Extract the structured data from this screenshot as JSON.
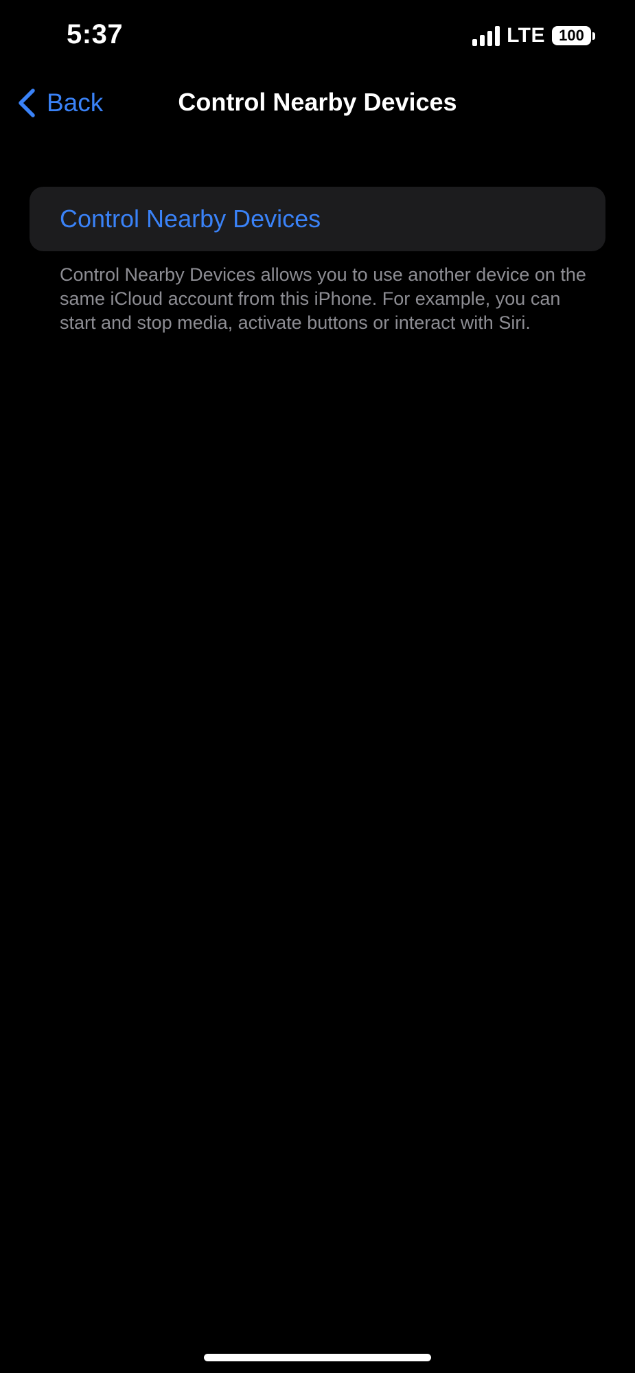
{
  "status_bar": {
    "time": "5:37",
    "network": "LTE",
    "battery": "100",
    "icons": {
      "signal": "cellular-signal-icon",
      "battery": "battery-icon"
    }
  },
  "nav": {
    "back_label": "Back",
    "title": "Control Nearby Devices",
    "back_icon": "chevron-left-icon"
  },
  "settings": {
    "row_label": "Control Nearby Devices",
    "footer": "Control Nearby Devices allows you to use another device on the same iCloud account from this iPhone. For example, you can start and stop media, activate buttons or interact with Siri."
  },
  "colors": {
    "accent": "#3a82f7",
    "background": "#000000",
    "group_background": "#1c1c1e",
    "secondary_text": "#8d8d93"
  }
}
